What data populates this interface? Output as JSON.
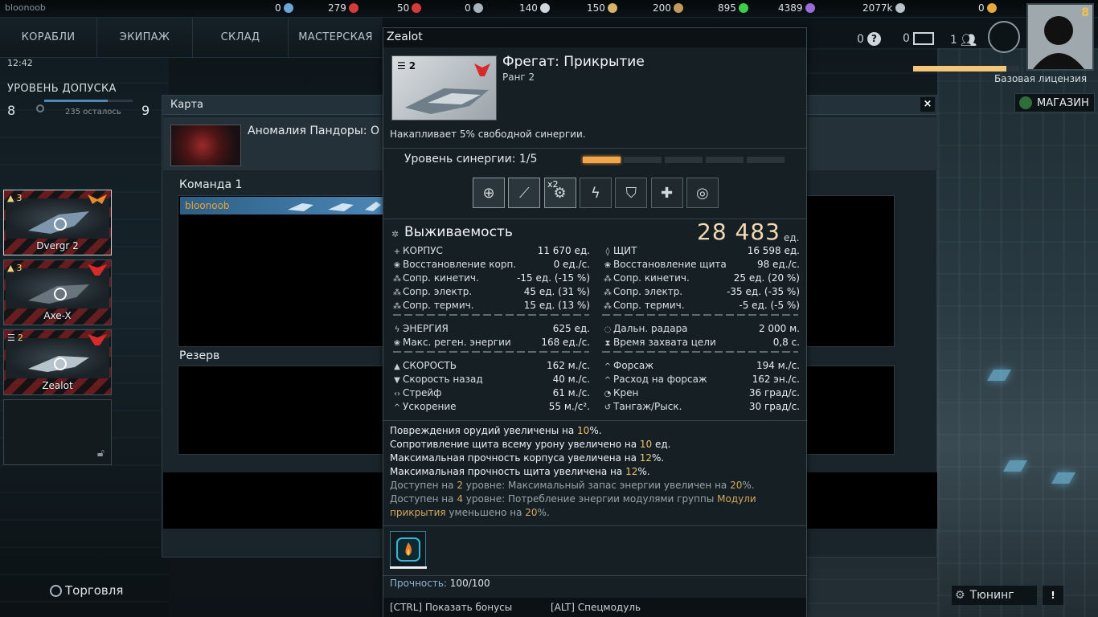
{
  "topbar": {
    "username": "bloonoob",
    "resources": [
      {
        "value": "0",
        "icon": "gear-cog-icon",
        "color": "#6aa7d8"
      },
      {
        "value": "279",
        "icon": "red-gem-icon",
        "color": "#d83a3a"
      },
      {
        "value": "50",
        "icon": "red-dice-icon",
        "color": "#d83a3a"
      },
      {
        "value": "0",
        "icon": "swirl-icon",
        "color": "#a8b4bb"
      },
      {
        "value": "140",
        "icon": "moon-icon",
        "color": "#cfd8dc"
      },
      {
        "value": "150",
        "icon": "wings-icon",
        "color": "#d8b36a"
      },
      {
        "value": "200",
        "icon": "eagle-icon",
        "color": "#c29a5a"
      },
      {
        "value": "895",
        "icon": "green-leaf-icon",
        "color": "#3ccf4a"
      },
      {
        "value": "4389",
        "icon": "purple-orb-icon",
        "color": "#9a6cd8"
      },
      {
        "value": "2077k",
        "icon": "credits-icon",
        "color": "#b8c2c8"
      },
      {
        "value": "0",
        "icon": "gold-coin-icon",
        "color": "#e6a93a"
      }
    ]
  },
  "nav": {
    "tabs": [
      "КОРАБЛИ",
      "ЭКИПАЖ",
      "СКЛАД",
      "МАСТЕРСКАЯ"
    ]
  },
  "status": {
    "clock": "12:42",
    "clearance_title": "УРОВЕНЬ ДОПУСКА",
    "level_current": "8",
    "level_next": "9",
    "remaining": "235 осталось",
    "progress": 0.72
  },
  "ships": [
    {
      "name": "Dvergr 2",
      "rank": "3",
      "faction_color": "#e88a2a",
      "selected": true
    },
    {
      "name": "Axe-X",
      "rank": "3",
      "faction_color": "#d82a2a",
      "selected": false
    },
    {
      "name": "Zealot",
      "rank": "2",
      "faction_color": "#d82a2a",
      "selected": false
    }
  ],
  "map": {
    "window_title": "Карта",
    "map_name": "Аномалия Пандоры: О",
    "team_label": "Команда 1",
    "player_name": "bloonoob",
    "reserve_label": "Резерв"
  },
  "topright": {
    "count_questions": "0",
    "count_mail": "0",
    "count_friends": "1",
    "player_level": "8",
    "license": "Базовая лицензия",
    "xp_progress": 0.88,
    "shop_label": "МАГАЗИН"
  },
  "bottom": {
    "trade_label": "Торговля",
    "tuning_label": "Тюнинг",
    "warn": "!"
  },
  "tooltip": {
    "title": "Zealot",
    "ship_rank_badge": "2",
    "ship_class": "Фрегат: Прикрытие",
    "ship_rank": "Ранг 2",
    "passive": "Накапливает 5% свободной синергии.",
    "synergy_label": "Уровень синергии: 1/5",
    "synergy_level": 1,
    "synergy_max": 5,
    "module_multiplier": "x2",
    "modules": [
      "target-scope-icon",
      "missile-rack-icon",
      "gear-engine-icon",
      "lightning-icon",
      "shield-icon",
      "medkit-icon",
      "radar-icon"
    ],
    "survivability_label": "Выживаемость",
    "survivability_total": "28 483",
    "survivability_unit": "ед.",
    "left_stats_1": [
      {
        "icon": "+",
        "label": "КОРПУС",
        "value": "11 670 ед."
      },
      {
        "icon": "❀",
        "label": "Восстановление корп.",
        "value": "0 ед./с."
      },
      {
        "icon": "⁂",
        "label": "Сопр. кинетич.",
        "value": "-15 ед. (-15 %)"
      },
      {
        "icon": "⁂",
        "label": "Сопр. электр.",
        "value": "45 ед. (31 %)"
      },
      {
        "icon": "⁂",
        "label": "Сопр. термич.",
        "value": "15 ед. (13 %)"
      }
    ],
    "right_stats_1": [
      {
        "icon": "◊",
        "label": "ЩИТ",
        "value": "16 598 ед."
      },
      {
        "icon": "❀",
        "label": "Восстановление щита",
        "value": "98 ед./с."
      },
      {
        "icon": "⁂",
        "label": "Сопр. кинетич.",
        "value": "25 ед. (20 %)"
      },
      {
        "icon": "⁂",
        "label": "Сопр. электр.",
        "value": "-35 ед. (-35 %)"
      },
      {
        "icon": "⁂",
        "label": "Сопр. термич.",
        "value": "-5 ед. (-5 %)"
      }
    ],
    "left_stats_2": [
      {
        "icon": "ϟ",
        "label": "ЭНЕРГИЯ",
        "value": "625 ед."
      },
      {
        "icon": "❀",
        "label": "Макс. реген. энергии",
        "value": "168 ед./с."
      }
    ],
    "right_stats_2": [
      {
        "icon": "◌",
        "label": "Дальн. радара",
        "value": "2 000 м."
      },
      {
        "icon": "⧗",
        "label": "Время захвата цели",
        "value": "0,8 с."
      }
    ],
    "left_stats_3": [
      {
        "icon": "▲",
        "label": "СКОРОСТЬ",
        "value": "162 м./с."
      },
      {
        "icon": "▼",
        "label": "Скорость назад",
        "value": "40 м./с."
      },
      {
        "icon": "‹›",
        "label": "Стрейф",
        "value": "61 м./с."
      },
      {
        "icon": "^",
        "label": "Ускорение",
        "value": "55 м./с²."
      }
    ],
    "right_stats_3": [
      {
        "icon": "^",
        "label": "Форсаж",
        "value": "194 м./с."
      },
      {
        "icon": "^",
        "label": "Расход на форсаж",
        "value": "162 эн./с."
      },
      {
        "icon": "◔",
        "label": "Крен",
        "value": "36 град/с."
      },
      {
        "icon": "↺",
        "label": "Тангаж/Рыск.",
        "value": "30 град/с."
      }
    ],
    "bonuses": [
      {
        "a": "Повреждения орудий увеличены на ",
        "h": "10",
        "b": "%."
      },
      {
        "a": "Сопротивление щита всему урону увеличено на ",
        "h": "10",
        "b": " ед."
      },
      {
        "a": "Максимальная прочность корпуса увеличена на ",
        "h": "12",
        "b": "%."
      },
      {
        "a": "Максимальная прочность щита увеличена на ",
        "h": "12",
        "b": "%."
      }
    ],
    "locked_bonuses": [
      {
        "a": "Доступен на ",
        "h": "2",
        "b": " уровне: Максимальный запас энергии увеличен на ",
        "h2": "20",
        "c": "%."
      },
      {
        "a": "Доступен на ",
        "h": "4",
        "b": " уровне: Потребление энергии модулями группы ",
        "h2": "Модули",
        "c": ""
      }
    ],
    "locked_bonus_cont": {
      "h": "прикрытия",
      "b": " уменьшено на ",
      "h2": "20",
      "c": "%."
    },
    "durability_label": "Прочность:",
    "durability_value": "100/100",
    "footer_ctrl": "[CTRL] Показать бонусы",
    "footer_alt": "[ALT] Спецмодуль"
  }
}
